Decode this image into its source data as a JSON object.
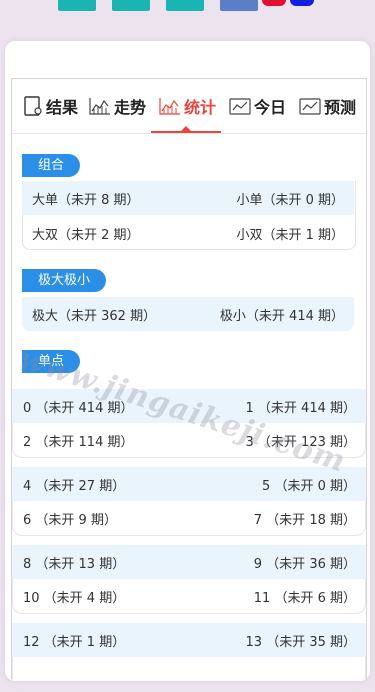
{
  "tabs": [
    {
      "label": "结果",
      "icon": "result-doc-icon"
    },
    {
      "label": "走势",
      "icon": "trend-chart-icon"
    },
    {
      "label": "统计",
      "icon": "stats-chart-icon",
      "active": true
    },
    {
      "label": "今日",
      "icon": "today-chart-icon"
    },
    {
      "label": "预测",
      "icon": "predict-chart-icon"
    }
  ],
  "sections": {
    "combo": {
      "title": "组合",
      "rows": [
        {
          "left": "大单（未开 8 期）",
          "right": "小单（未开 0 期）"
        },
        {
          "left": "大双（未开 2 期）",
          "right": "小双（未开 1 期）"
        }
      ]
    },
    "extreme": {
      "title": "极大极小",
      "rows": [
        {
          "left": "极大（未开 362 期）",
          "right": "极小（未开 414 期）"
        }
      ]
    },
    "single": {
      "title": "单点",
      "rows": [
        {
          "left": "0 （未开 414 期）",
          "right": "1 （未开 414 期）"
        },
        {
          "left": "2 （未开 114 期）",
          "right": "3 （未开 123 期）"
        },
        {
          "left": "4 （未开 27 期）",
          "right": "5 （未开 0 期）"
        },
        {
          "left": "6 （未开 9 期）",
          "right": "7 （未开 18 期）"
        },
        {
          "left": "8 （未开 13 期）",
          "right": "9 （未开 36 期）"
        },
        {
          "left": "10 （未开 4 期）",
          "right": "11 （未开 6 期）"
        },
        {
          "left": "12 （未开 1 期）",
          "right": "13 （未开 35 期）"
        }
      ]
    }
  },
  "watermark": "www.jingaikeji.com",
  "colors": {
    "accent": "#e8453c",
    "pill": "#2b8fe8",
    "row_shade": "#e9f4fd",
    "top_buttons": [
      "#1ab5b2",
      "#1ab5b2",
      "#1ab5b2",
      "#5a7fc8"
    ],
    "top_dots": [
      "#e01030",
      "#1020e0"
    ]
  }
}
